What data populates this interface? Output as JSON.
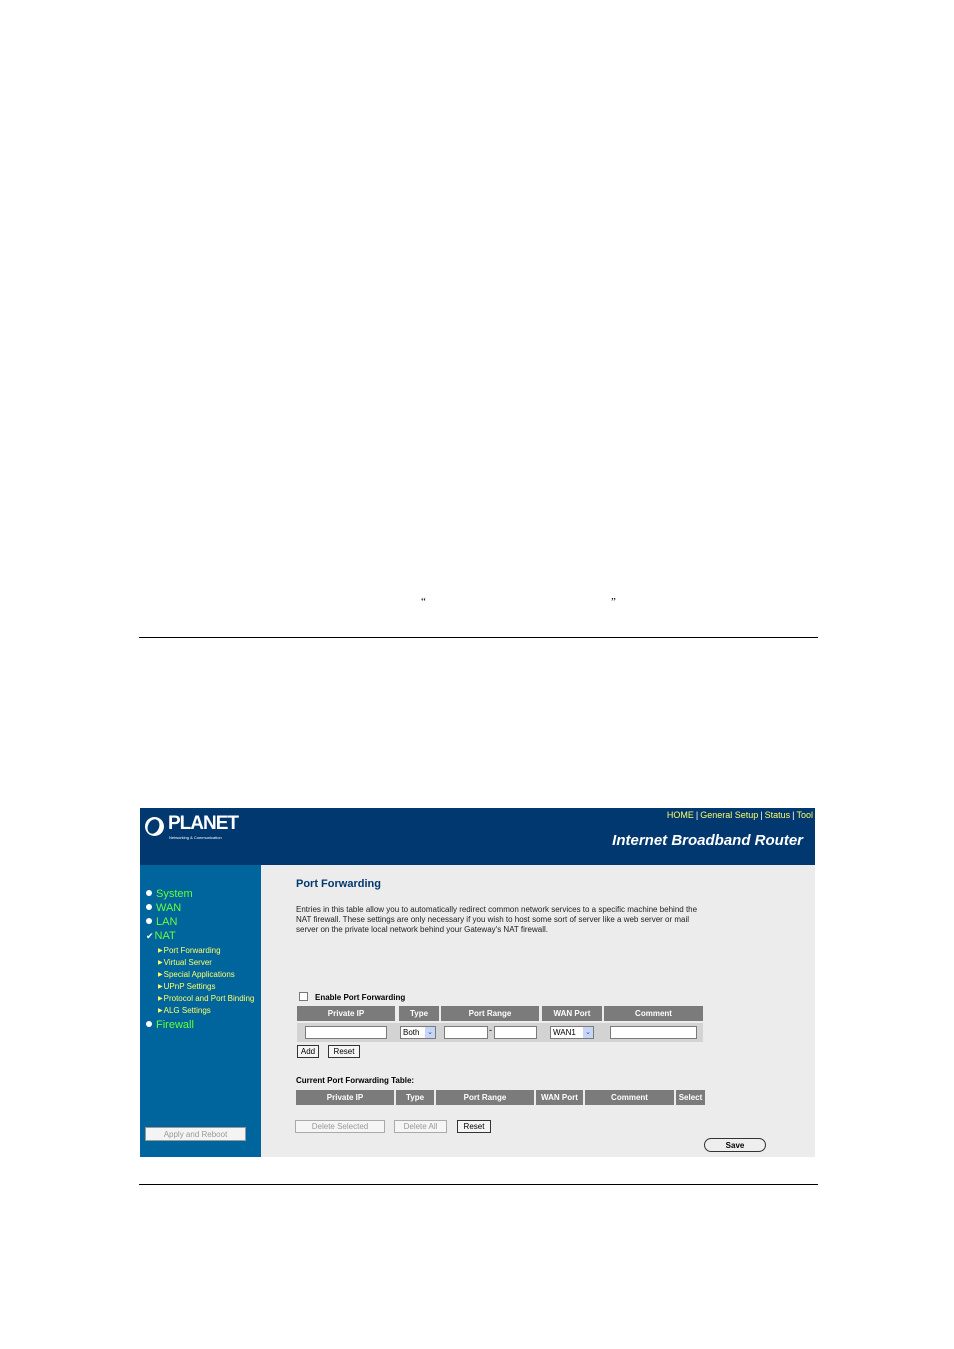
{
  "document": {
    "open_quote": "“",
    "close_quote": "”"
  },
  "header": {
    "brand": "PLANET",
    "brand_tagline": "Networking & Communication",
    "nav": [
      "HOME",
      "General Setup",
      "Status",
      "Tool"
    ],
    "nav_separator": "|",
    "product": "Internet Broadband Router"
  },
  "sidebar": {
    "menu": [
      "System",
      "WAN",
      "LAN",
      "NAT",
      "Firewall"
    ],
    "nat_submenu": [
      "Port Forwarding",
      "Virtual Server",
      "Special Applications",
      "UPnP Settings",
      "Protocol and Port Binding",
      "ALG Settings"
    ],
    "apply_reboot": "Apply and Reboot"
  },
  "content": {
    "title": "Port Forwarding",
    "description": "Entries in this table allow you to automatically redirect common network services to a specific machine behind the NAT firewall. These settings are only necessary if you wish to host some sort of server like a web server or mail server on the private local network behind your Gateway's NAT firewall.",
    "enable_label": "Enable Port Forwarding",
    "form_headers": [
      "Private IP",
      "Type",
      "Port Range",
      "WAN Port",
      "Comment"
    ],
    "type_value": "Both",
    "range_separator": "-",
    "wan_value": "WAN1",
    "add_button": "Add",
    "reset_button": "Reset",
    "table_title": "Current Port Forwarding Table:",
    "table_headers": [
      "Private IP",
      "Type",
      "Port Range",
      "WAN Port",
      "Comment",
      "Select"
    ],
    "delete_selected": "Delete Selected",
    "delete_all": "Delete All",
    "table_reset": "Reset",
    "save": "Save"
  },
  "colors": {
    "header_bg": "#00386f",
    "sidebar_bg": "#00659c",
    "menu_text": "#66ff33",
    "submenu_text": "#ffff66",
    "content_bg": "#ececec",
    "table_header_bg": "#7b7b7b"
  }
}
